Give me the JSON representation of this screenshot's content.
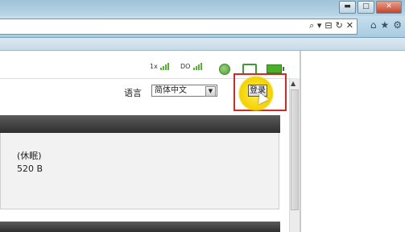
{
  "window": {
    "controls": {
      "minimize": "▬",
      "maximize": "□",
      "close": "✕"
    }
  },
  "navbar": {
    "address_tools": [
      "⌕ ▾",
      "⊟",
      "↻",
      "✕"
    ],
    "icons": [
      "⌂",
      "★",
      "⚙"
    ]
  },
  "status": {
    "signal_1x": "1x",
    "signal_do": "DO",
    "globe_icon": "🌐"
  },
  "language": {
    "label": "语言",
    "selected": "简体中文",
    "arrow": "▼"
  },
  "login": {
    "label": "登录"
  },
  "device": {
    "state": "(休眠)",
    "size": "520 B"
  },
  "scroll": {
    "up": "▲"
  },
  "colors": {
    "highlight_border": "#d12a24",
    "cursor_spot": "#f2d200",
    "signal_green": "#5cae3a",
    "panel_dark": "#2e2e2e"
  }
}
